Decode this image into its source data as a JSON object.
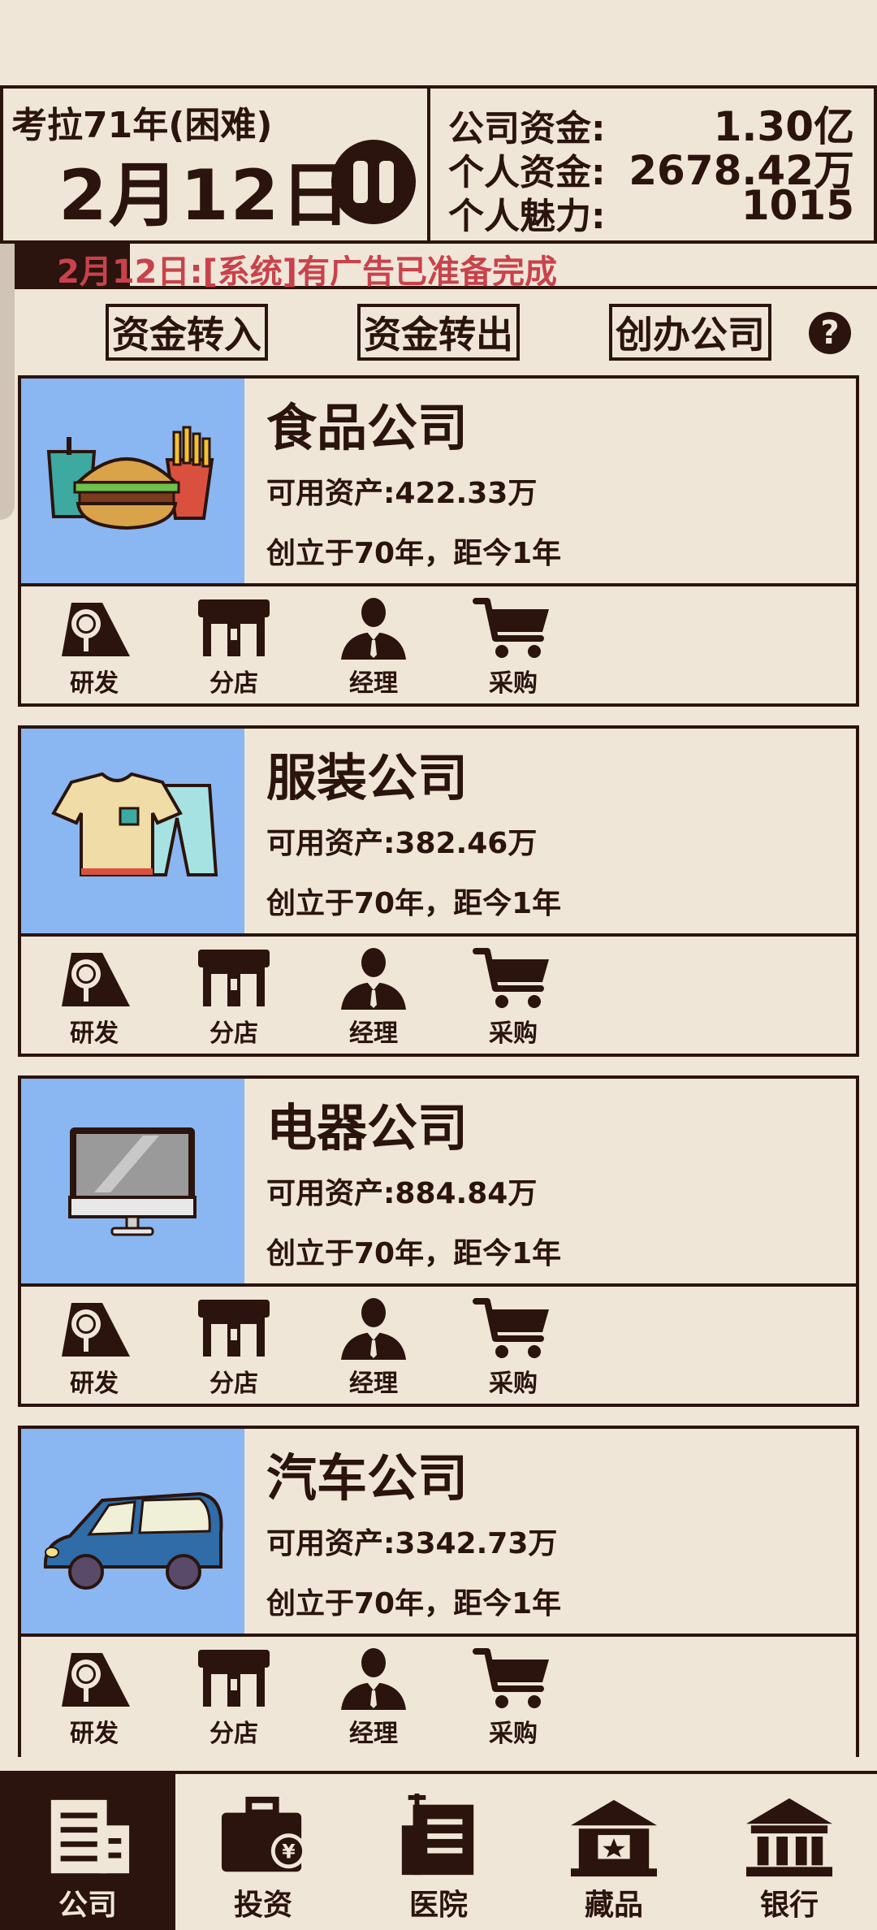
{
  "header": {
    "year_label": "考拉71年(困难)",
    "date": "2月12日",
    "stats": [
      {
        "label": "公司资金:",
        "value": "1.30亿"
      },
      {
        "label": "个人资金:",
        "value": "2678.42万"
      },
      {
        "label": "个人魅力:",
        "value": "1015"
      }
    ]
  },
  "ticker": {
    "text": "2月12日:[系统]有广告已准备完成"
  },
  "toolbar": {
    "transfer_in": "资金转入",
    "transfer_out": "资金转出",
    "create_company": "创办公司",
    "help": "?"
  },
  "actions": [
    "研发",
    "分店",
    "经理",
    "采购"
  ],
  "companies": [
    {
      "name": "食品公司",
      "assets": "可用资产:422.33万",
      "founded": "创立于70年，距今1年",
      "icon": "burger-fries-icon"
    },
    {
      "name": "服装公司",
      "assets": "可用资产:382.46万",
      "founded": "创立于70年，距今1年",
      "icon": "clothes-icon"
    },
    {
      "name": "电器公司",
      "assets": "可用资产:884.84万",
      "founded": "创立于70年，距今1年",
      "icon": "monitor-icon"
    },
    {
      "name": "汽车公司",
      "assets": "可用资产:3342.73万",
      "founded": "创立于70年，距今1年",
      "icon": "car-icon"
    }
  ],
  "nav": [
    {
      "label": "公司",
      "icon": "company-icon",
      "active": true
    },
    {
      "label": "投资",
      "icon": "investment-icon",
      "active": false
    },
    {
      "label": "医院",
      "icon": "hospital-icon",
      "active": false
    },
    {
      "label": "藏品",
      "icon": "collection-icon",
      "active": false
    },
    {
      "label": "银行",
      "icon": "bank-icon",
      "active": false
    }
  ],
  "colors": {
    "background": "#efe6d8",
    "dark": "#2a140d",
    "ticker_red": "#c9424b",
    "image_bg": "#8ab6f2"
  }
}
